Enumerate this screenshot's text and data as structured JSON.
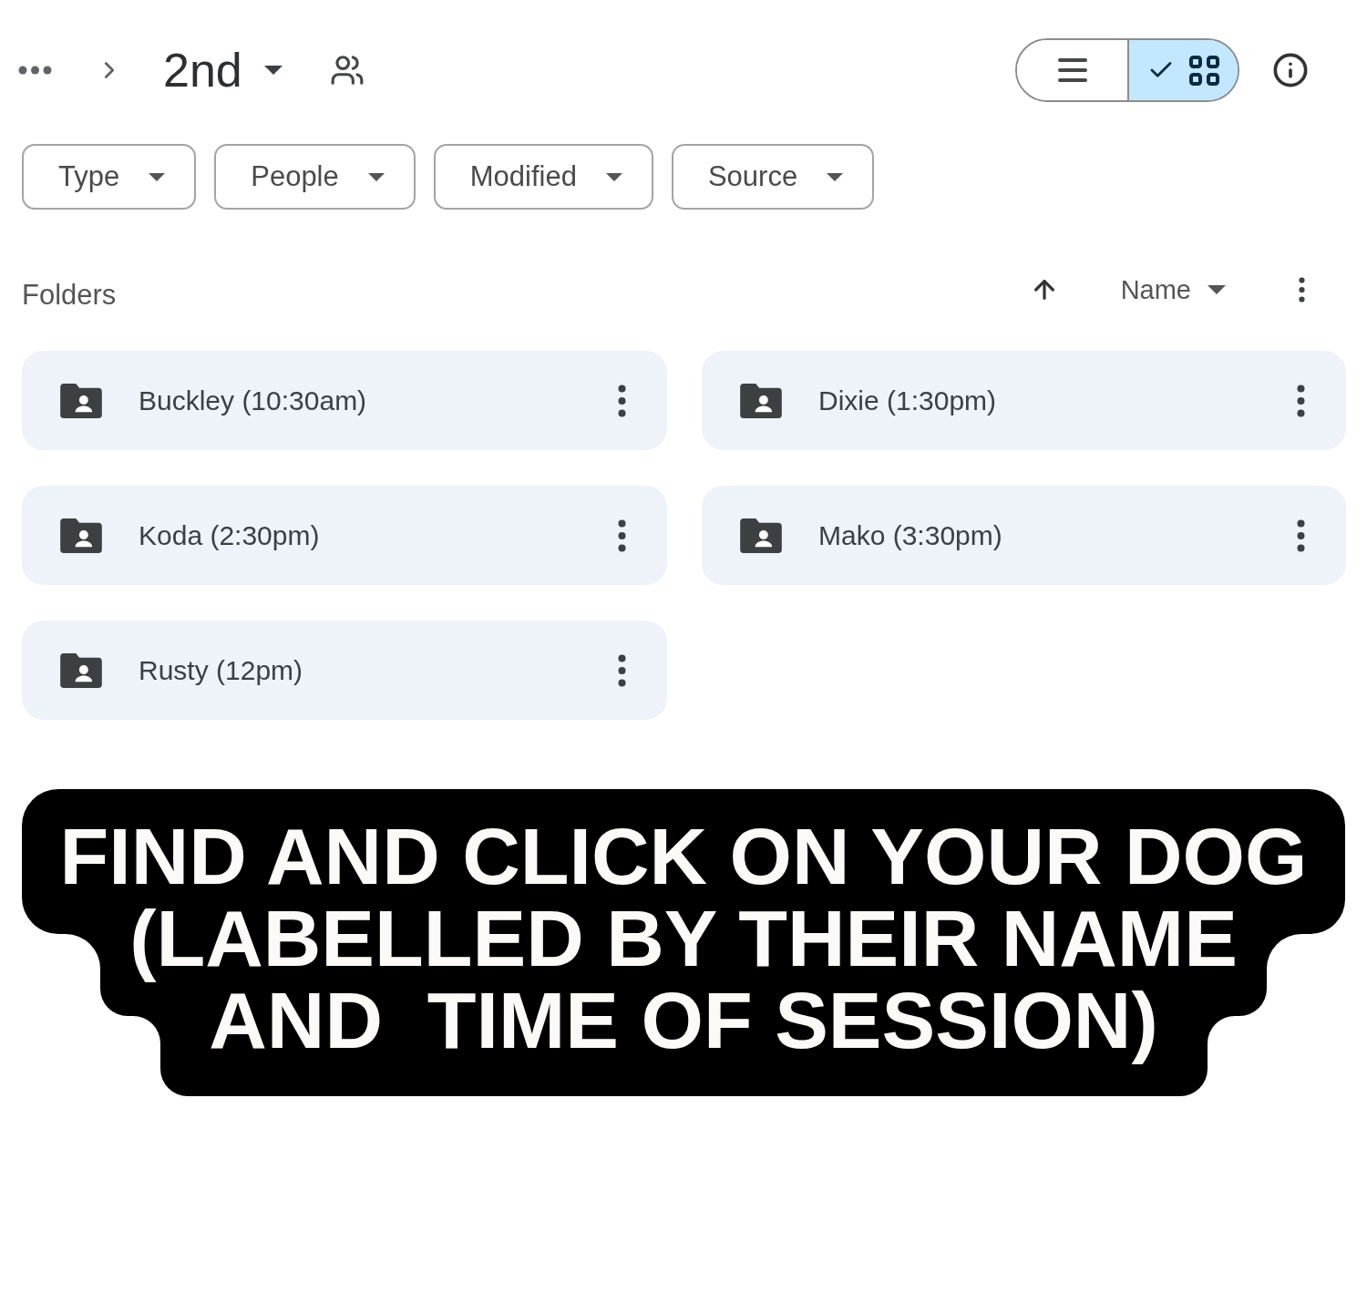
{
  "breadcrumb": {
    "current": "2nd"
  },
  "view_toggle": [
    {
      "kind": "list",
      "selected": false
    },
    {
      "kind": "grid",
      "selected": true
    }
  ],
  "filters": [
    "Type",
    "People",
    "Modified",
    "Source"
  ],
  "section_title": "Folders",
  "sort": {
    "field": "Name",
    "ascending": true
  },
  "folders": [
    "Buckley (10:30am)",
    "Dixie (1:30pm)",
    "Koda (2:30pm)",
    "Mako (3:30pm)",
    "Rusty (12pm)"
  ],
  "caption": "FIND AND CLICK ON YOUR DOG\n(LABELLED BY THEIR NAME\nAND  TIME OF SESSION)"
}
